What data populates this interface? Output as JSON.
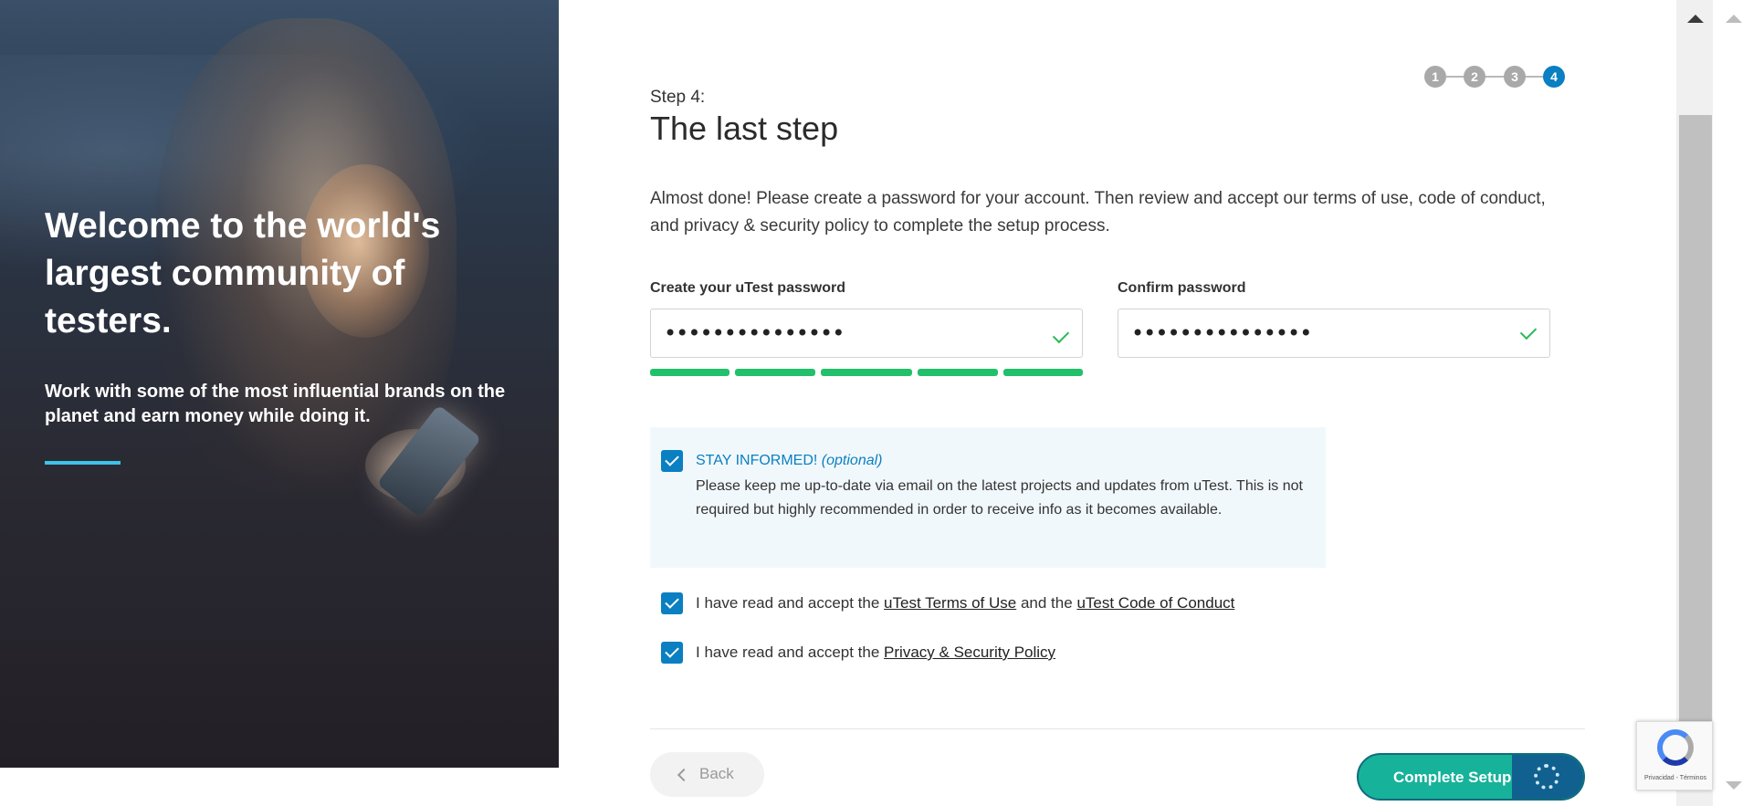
{
  "hero": {
    "title": "Welcome to the world's largest community of testers.",
    "subtitle": "Work with some of the most influential brands on the planet and earn money while doing it."
  },
  "stepper": {
    "steps": [
      "1",
      "2",
      "3",
      "4"
    ],
    "active": 4
  },
  "form": {
    "step_label": "Step 4:",
    "title": "The last step",
    "intro": "Almost done! Please create a password for your account. Then review and accept our terms of use, code of conduct, and privacy & security policy to complete the setup process.",
    "password": {
      "label": "Create your uTest password",
      "value": "•••••••••••••••",
      "valid": true,
      "strength_segments": 5,
      "strength_filled": 5
    },
    "confirm": {
      "label": "Confirm password",
      "value": "•••••••••••••••",
      "valid": true
    },
    "stay_informed": {
      "title": "STAY INFORMED!",
      "optional": "(optional)",
      "text": "Please keep me up-to-date via email on the latest projects and updates from uTest. This is not required but highly recommended in order to receive info as it becomes available.",
      "checked": true
    },
    "terms": {
      "prefix": "I have read and accept the",
      "link1": "uTest Terms of Use",
      "middle": "and the",
      "link2": "uTest Code of Conduct",
      "checked": true
    },
    "privacy": {
      "prefix": "I have read and accept the",
      "link": "Privacy & Security Policy",
      "checked": true
    }
  },
  "buttons": {
    "back": "Back",
    "complete": "Complete Setup"
  },
  "recaptcha": {
    "text": "Privacidad - Términos"
  },
  "colors": {
    "accent": "#0a7fc1",
    "success": "#22c06a",
    "primary_button": "#17b29a",
    "spinner_zone": "#10618f"
  }
}
